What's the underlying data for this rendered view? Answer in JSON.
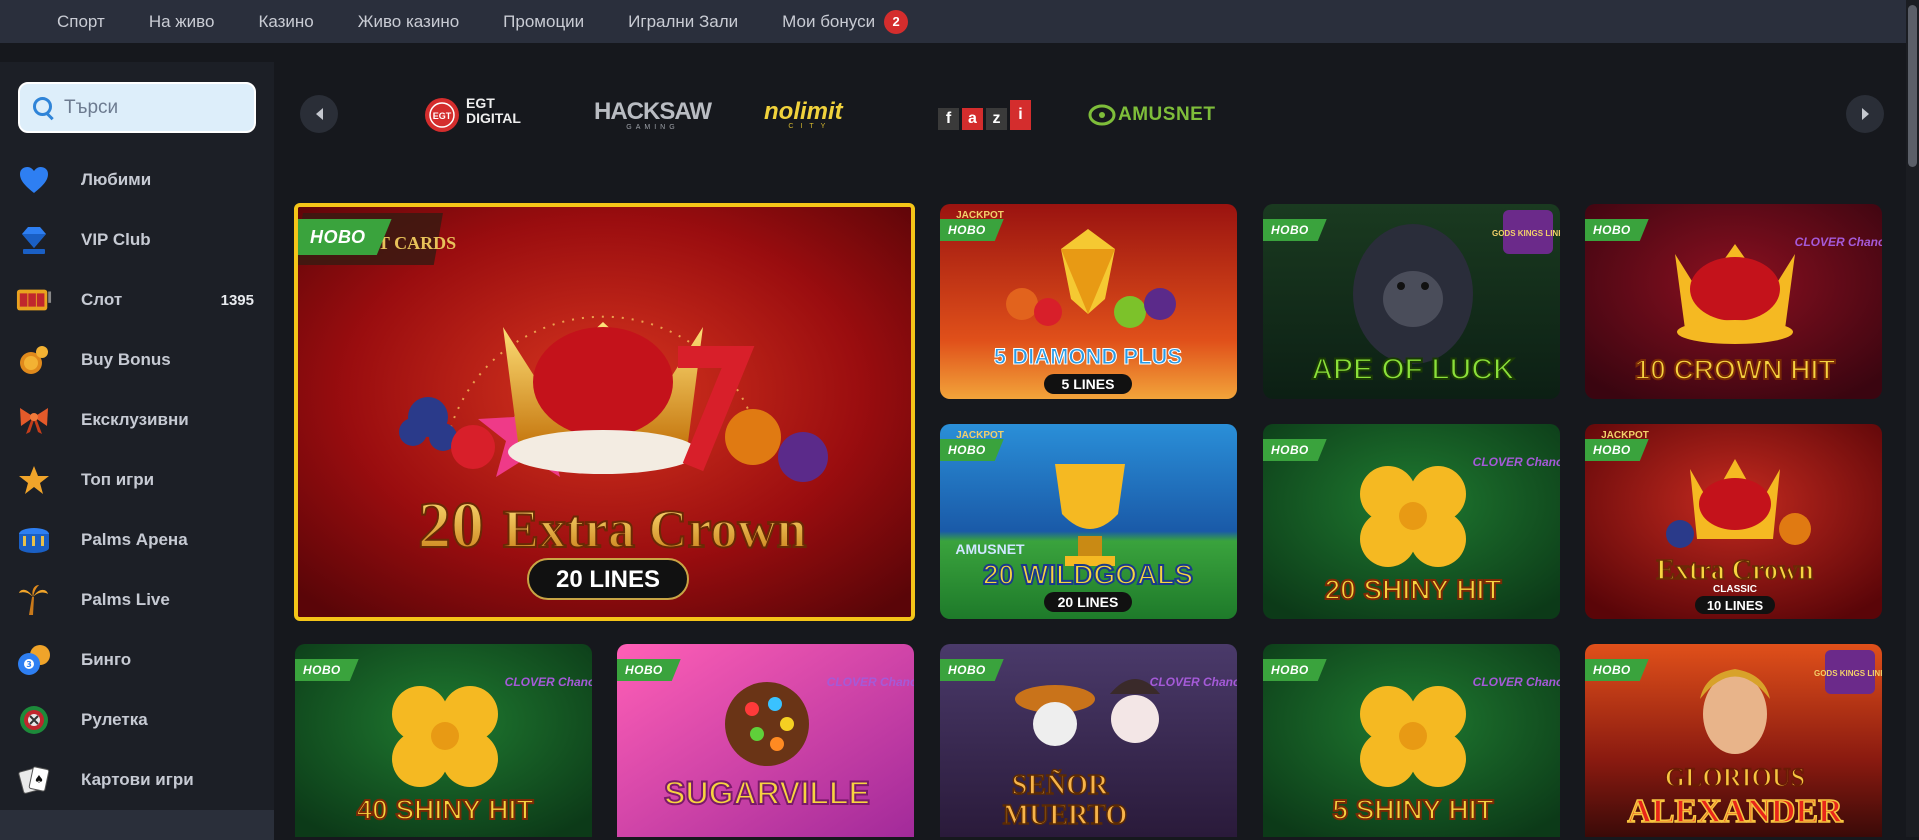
{
  "topnav": {
    "items": [
      "Спорт",
      "На живо",
      "Казино",
      "Живо казино",
      "Промоции",
      "Игрални Зали",
      "Мои бонуси"
    ],
    "bonus_badge": "2"
  },
  "sidebar": {
    "search_placeholder": "Търси",
    "items": [
      {
        "label": "Любими",
        "icon": "heart-icon"
      },
      {
        "label": "VIP Club",
        "icon": "diamond-icon"
      },
      {
        "label": "Слот",
        "icon": "slot-machine-icon",
        "count": "1395"
      },
      {
        "label": "Buy Bonus",
        "icon": "coins-icon"
      },
      {
        "label": "Ексклузивни",
        "icon": "bow-icon"
      },
      {
        "label": "Топ игри",
        "icon": "star-icon"
      },
      {
        "label": "Palms Арена",
        "icon": "arena-icon"
      },
      {
        "label": "Palms Live",
        "icon": "palm-icon"
      },
      {
        "label": "Бинго",
        "icon": "bingo-ball-icon"
      },
      {
        "label": "Рулетка",
        "icon": "roulette-icon"
      },
      {
        "label": "Картови игри",
        "icon": "cards-icon"
      }
    ]
  },
  "providers": {
    "logos": [
      "EGT DIGITAL",
      "HACKSAW GAMING",
      "NOLIMIT CITY",
      "fazi",
      "AMUSNET"
    ],
    "egt_mark": "EGT",
    "hacksaw_sub": "GAMING",
    "nolimit_sub": "CITY",
    "fazi_letters": [
      "f",
      "a",
      "z",
      "i"
    ]
  },
  "tag_new": "НОВО",
  "games": {
    "featured": {
      "title_num": "20",
      "title": "Extra Crown",
      "lines": "20 LINES",
      "badge": "JACKPOT CARDS"
    },
    "diamond_plus": {
      "title": "5 DIAMOND PLUS",
      "lines": "5 LINES",
      "badge": "JACKPOT"
    },
    "ape_of_luck": {
      "title": "APE OF LUCK",
      "badge": "GODS KINGS LINK"
    },
    "crown_hit_10": {
      "title": "10 CROWN HIT",
      "badge": "CLOVER Chance"
    },
    "wild_goals": {
      "title": "20 WILDGOALS",
      "lines": "20 LINES",
      "badge": "JACKPOT",
      "banner": "AMUSNET"
    },
    "shiny_hit_20": {
      "title": "20 SHINY HIT",
      "badge": "CLOVER Chance"
    },
    "extra_crown_classic": {
      "title": "Extra Crown",
      "sub": "CLASSIC",
      "lines": "10 LINES",
      "badge": "JACKPOT"
    },
    "shiny_hit_40": {
      "title": "40 SHINY HIT",
      "badge": "CLOVER Chance"
    },
    "sugarville": {
      "title": "SUGARVILLE",
      "badge": "CLOVER Chance"
    },
    "senor_muerto": {
      "title_1": "SEÑOR",
      "title_2": "MUERTO",
      "badge": "CLOVER Chance"
    },
    "shiny_hit_5": {
      "title": "5 SHINY HIT",
      "badge": "CLOVER Chance"
    },
    "glorious_alexander": {
      "title_1": "GLORIOUS",
      "title_2": "ALEXANDER",
      "badge": "GODS KINGS LINK"
    }
  }
}
